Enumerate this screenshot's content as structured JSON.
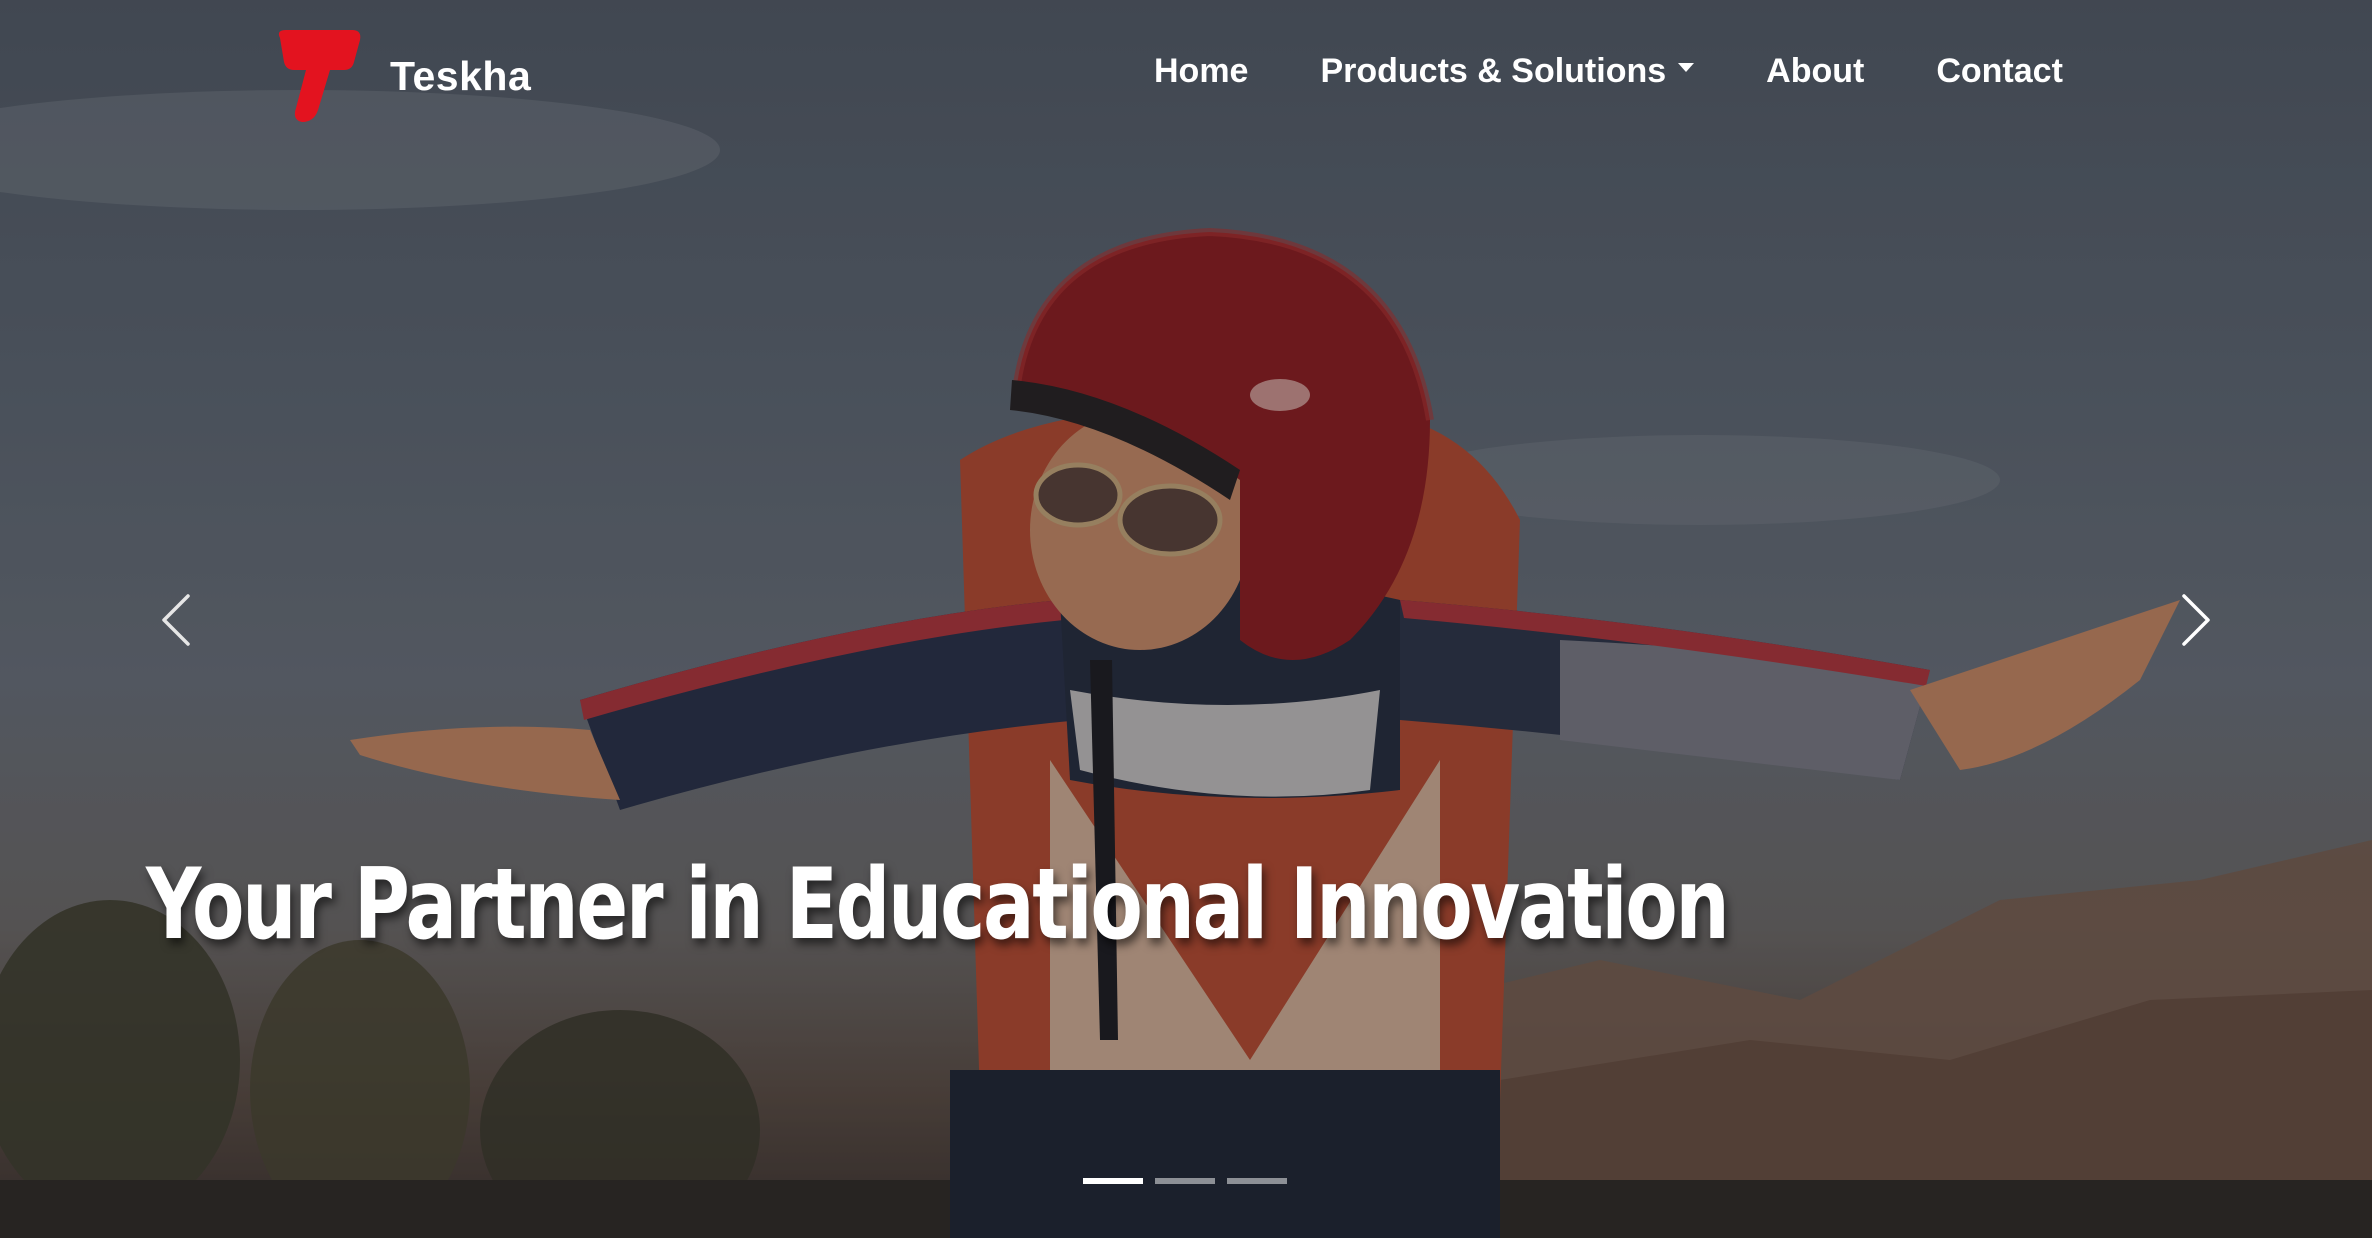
{
  "brand": {
    "name": "Teskha",
    "logo_color": "#e3131f"
  },
  "nav": {
    "items": [
      {
        "label": "Home"
      },
      {
        "label": "Products & Solutions",
        "has_dropdown": true
      },
      {
        "label": "About"
      },
      {
        "label": "Contact"
      }
    ]
  },
  "carousel": {
    "caption": "Your Partner in Educational Innovation",
    "slide_image": "child-with-red-helmet-in-rocket-costume",
    "slide_count": 3,
    "active_slide": 1,
    "prev_icon": "chevron-left-icon",
    "next_icon": "chevron-right-icon"
  }
}
